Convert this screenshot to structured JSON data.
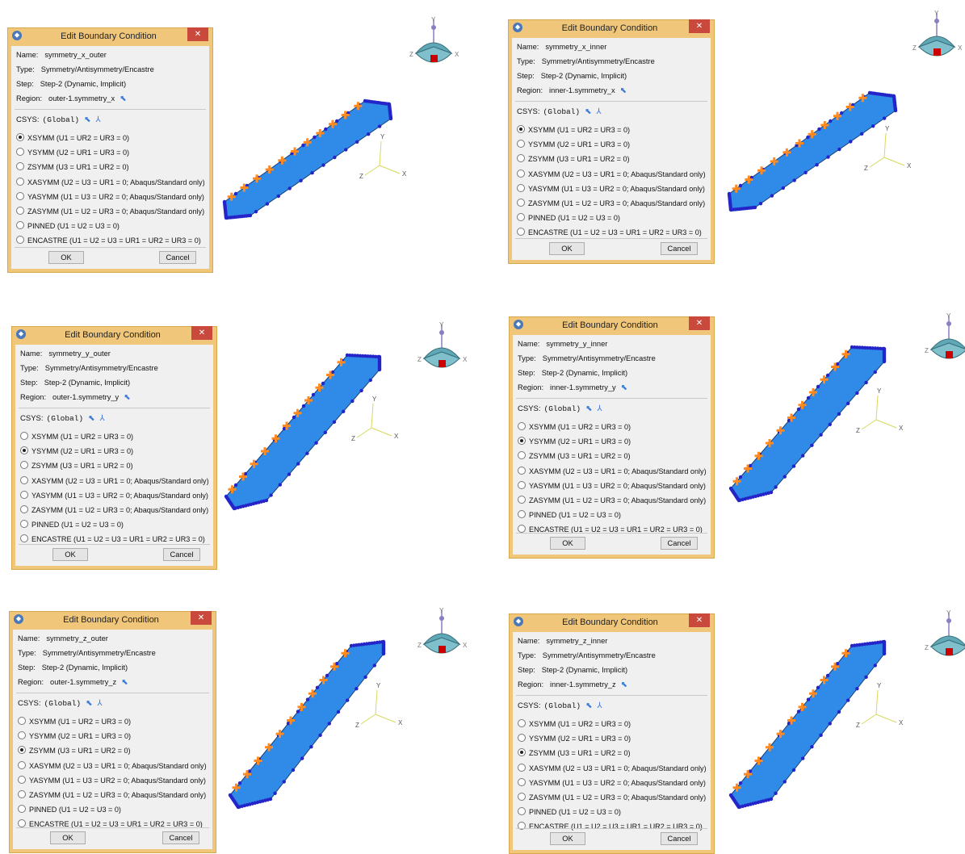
{
  "dialog_title": "Edit Boundary Condition",
  "labels": {
    "name": "Name:",
    "type": "Type:",
    "step": "Step:",
    "region": "Region:",
    "csys": "CSYS:",
    "csys_value": "(Global)"
  },
  "buttons": {
    "ok": "OK",
    "cancel": "Cancel"
  },
  "options": [
    "XSYMM (U1 = UR2 = UR3 = 0)",
    "YSYMM (U2 = UR1 = UR3 = 0)",
    "ZSYMM (U3 = UR1 = UR2 = 0)",
    "XASYMM (U2 = U3 = UR1 = 0; Abaqus/Standard only)",
    "YASYMM (U1 = U3 = UR2 = 0; Abaqus/Standard only)",
    "ZASYMM (U1 = U2 = UR3 = 0; Abaqus/Standard only)",
    "PINNED (U1 = U2 = U3 = 0)",
    "ENCASTRE (U1 = U2 = U3 = UR1 = UR2 = UR3 = 0)"
  ],
  "axes": {
    "x": "X",
    "y": "Y",
    "z": "Z"
  },
  "dialogs": [
    {
      "name": "symmetry_x_outer",
      "type": "Symmetry/Antisymmetry/Encastre",
      "step": "Step-2 (Dynamic, Implicit)",
      "region": "outer-1.symmetry_x",
      "selected": 0
    },
    {
      "name": "symmetry_x_inner",
      "type": "Symmetry/Antisymmetry/Encastre",
      "step": "Step-2 (Dynamic, Implicit)",
      "region": "inner-1.symmetry_x",
      "selected": 0
    },
    {
      "name": "symmetry_y_outer",
      "type": "Symmetry/Antisymmetry/Encastre",
      "step": "Step-2 (Dynamic, Implicit)",
      "region": "outer-1.symmetry_y",
      "selected": 1
    },
    {
      "name": "symmetry_y_inner",
      "type": "Symmetry/Antisymmetry/Encastre",
      "step": "Step-2 (Dynamic, Implicit)",
      "region": "inner-1.symmetry_y",
      "selected": 1
    },
    {
      "name": "symmetry_z_outer",
      "type": "Symmetry/Antisymmetry/Encastre",
      "step": "Step-2 (Dynamic, Implicit)",
      "region": "outer-1.symmetry_z",
      "selected": 2
    },
    {
      "name": "symmetry_z_inner",
      "type": "Symmetry/Antisymmetry/Encastre",
      "step": "Step-2 (Dynamic, Implicit)",
      "region": "inner-1.symmetry_z",
      "selected": 2
    }
  ],
  "colors": {
    "dialog_frame": "#f0c77a",
    "close_button": "#c94a3c",
    "part_fill": "#2f8ae8",
    "bc_markers": "#ff8a1f",
    "edge_markers": "#2424c8",
    "view_cube": "#5fa8b8"
  }
}
